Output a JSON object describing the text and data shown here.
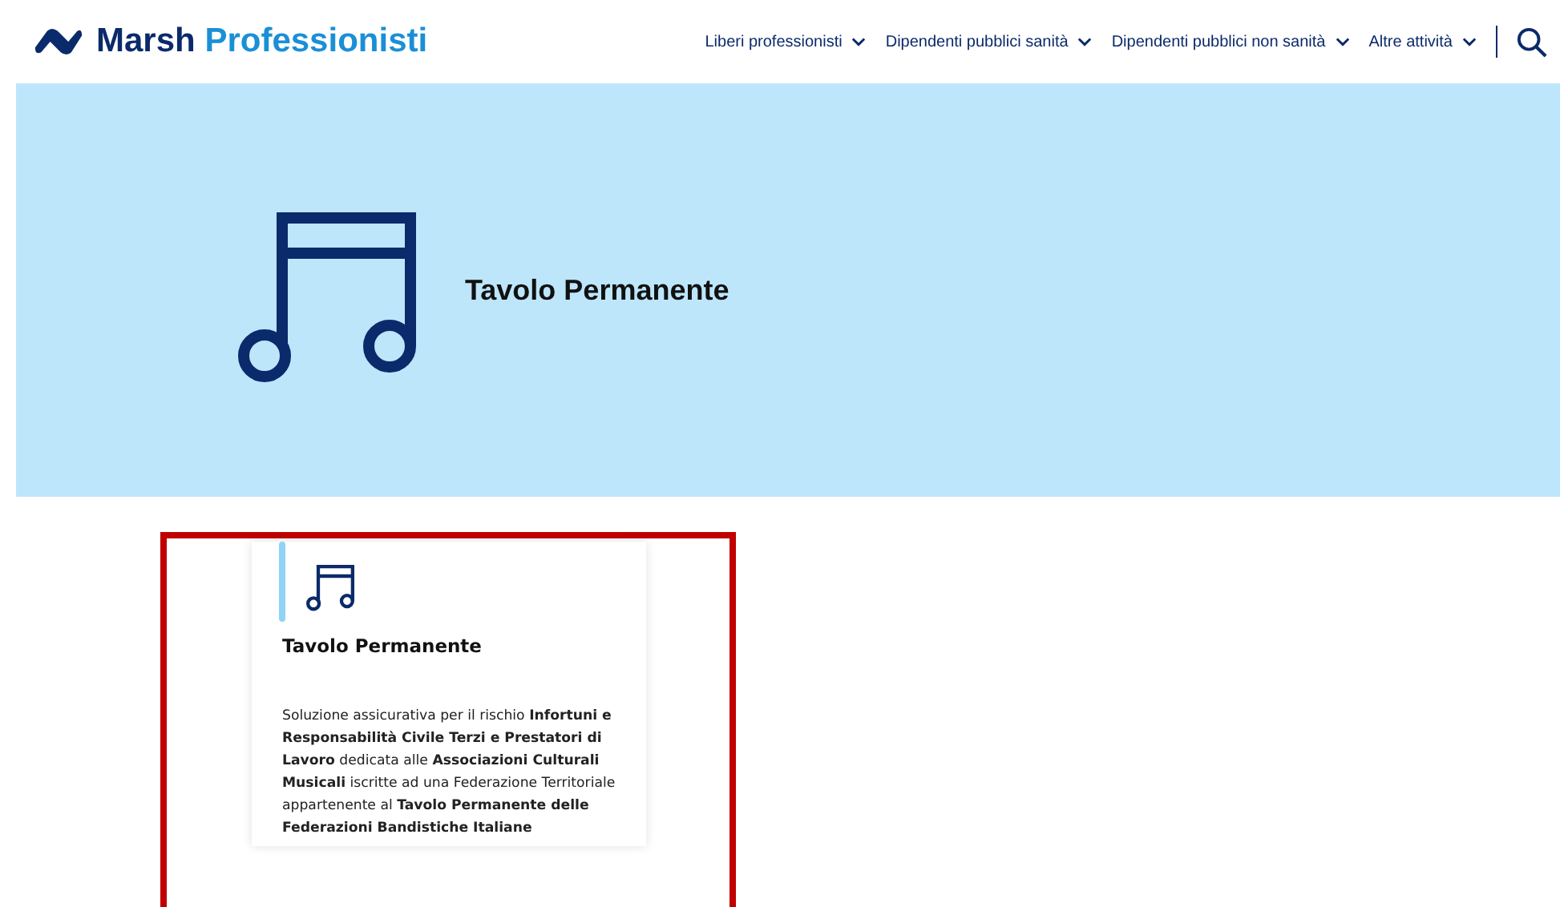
{
  "header": {
    "logo_words": [
      "Marsh",
      "Professionisti"
    ],
    "nav": [
      {
        "label": "Liberi professionisti"
      },
      {
        "label": "Dipendenti pubblici sanità"
      },
      {
        "label": "Dipendenti pubblici non sanità"
      },
      {
        "label": "Altre attività"
      }
    ]
  },
  "hero": {
    "title": "Tavolo Permanente"
  },
  "card": {
    "title": "Tavolo Permanente",
    "text": "Soluzione assicurativa per il rischio **Infortuni e Responsabilità Civile Terzi e Prestatori di Lavoro** dedicata alle **Associazioni Culturali Musicali** iscritte ad una Federazione Territoriale appartenente al **Tavolo Permanente delle Federazioni Bandistiche Italiane**"
  }
}
